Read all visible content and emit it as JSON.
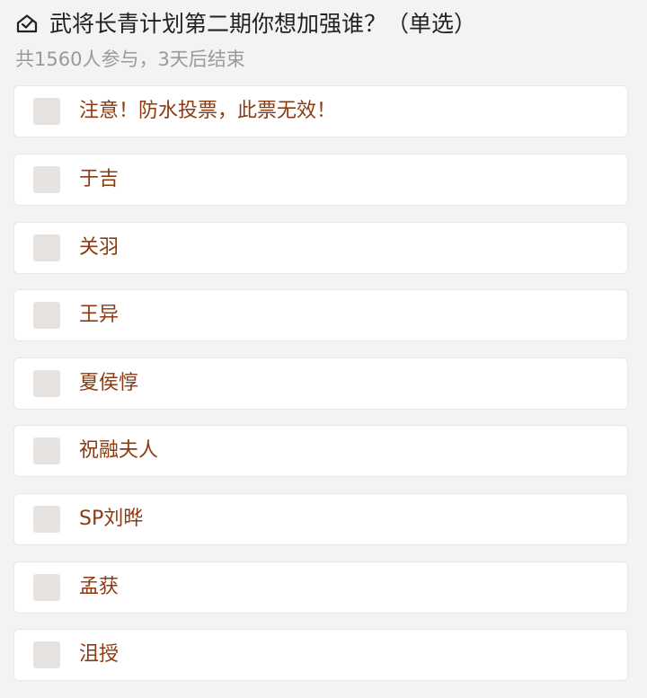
{
  "poll": {
    "icon": "checkmark-envelope-icon",
    "title": "武将长青计划第二期你想加强谁？（单选）",
    "meta": "共1560人参与，3天后结束",
    "options": [
      {
        "label": "注意！防水投票，此票无效！",
        "checked": false
      },
      {
        "label": "于吉",
        "checked": false
      },
      {
        "label": "关羽",
        "checked": false
      },
      {
        "label": "王异",
        "checked": false
      },
      {
        "label": "夏侯惇",
        "checked": false
      },
      {
        "label": "祝融夫人",
        "checked": false
      },
      {
        "label": "SP刘晔",
        "checked": false
      },
      {
        "label": "孟获",
        "checked": false
      },
      {
        "label": "沮授",
        "checked": false
      }
    ]
  },
  "colors": {
    "background": "#f4f3f3",
    "card": "#ffffff",
    "checkbox": "#e7e3e1",
    "option_text": "#8b3a12",
    "title_text": "#222222",
    "meta_text": "#9a9a9a"
  }
}
